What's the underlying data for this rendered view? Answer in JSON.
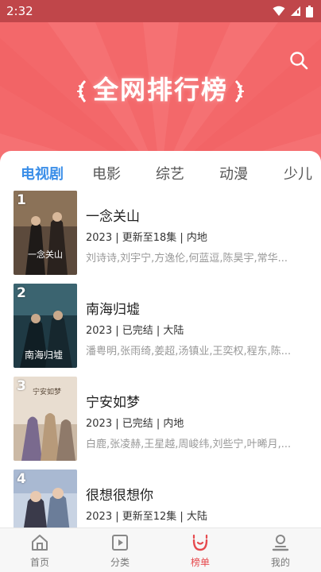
{
  "status_bar": {
    "time": "2:32"
  },
  "header": {
    "title": "全网排行榜"
  },
  "tabs": [
    {
      "label": "电视剧",
      "active": true
    },
    {
      "label": "电影"
    },
    {
      "label": "综艺"
    },
    {
      "label": "动漫"
    },
    {
      "label": "少儿"
    }
  ],
  "items": [
    {
      "rank": "1",
      "title": "一念关山",
      "meta": "2023 | 更新至18集 | 内地",
      "cast": "刘诗诗,刘宇宁,方逸伦,何蓝逗,陈昊宇,常华..."
    },
    {
      "rank": "2",
      "title": "南海归墟",
      "meta": "2023 | 已完结 | 大陆",
      "cast": "潘粤明,张雨绮,姜超,汤镇业,王奕权,程东,陈..."
    },
    {
      "rank": "3",
      "title": "宁安如梦",
      "meta": "2023 | 已完结 | 内地",
      "cast": "白鹿,张凌赫,王星越,周峻纬,刘些宁,叶晞月,..."
    },
    {
      "rank": "4",
      "title": "很想很想你",
      "meta": "2023 | 更新至12集 | 大陆",
      "cast": ""
    }
  ],
  "bottom_nav": [
    {
      "label": "首页",
      "icon": "home-icon"
    },
    {
      "label": "分类",
      "icon": "category-icon"
    },
    {
      "label": "榜单",
      "icon": "ranking-icon",
      "active": true
    },
    {
      "label": "我的",
      "icon": "profile-icon"
    }
  ],
  "colors": {
    "header_bg": "#f3686a",
    "status_bg": "#c0464a",
    "accent_tab": "#3a8ee8",
    "accent_nav": "#e64a4e"
  }
}
